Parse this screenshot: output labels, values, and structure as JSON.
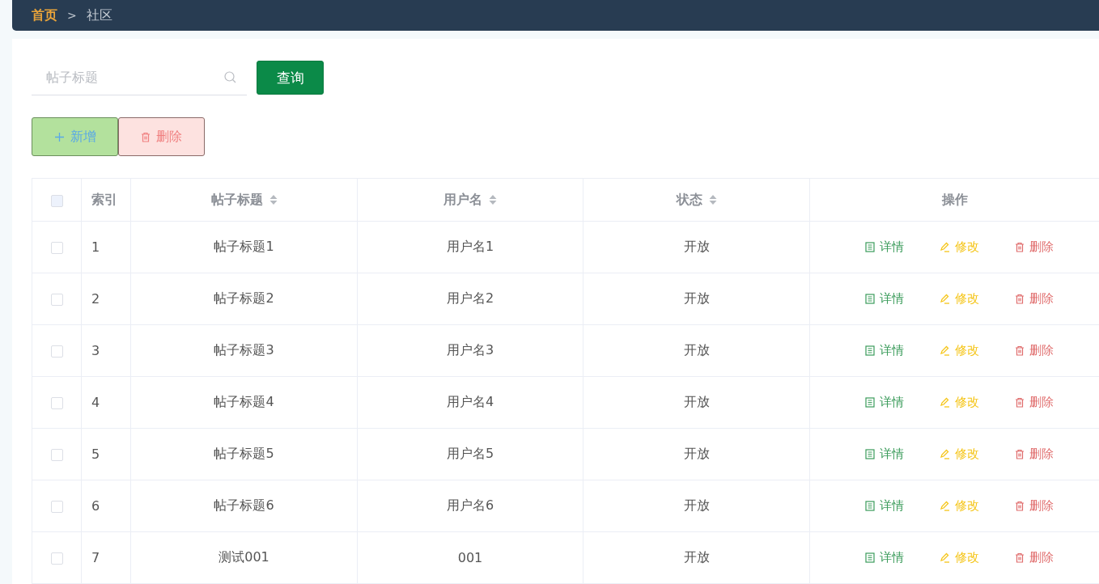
{
  "breadcrumb": [
    {
      "label": "首页",
      "current": false
    },
    {
      "label": "社区",
      "current": true
    }
  ],
  "breadcrumb_separator": ">",
  "search": {
    "placeholder": "帖子标题",
    "button": "查询"
  },
  "actions": [
    {
      "kind": "add",
      "label": "新增"
    },
    {
      "kind": "delete",
      "label": "删除"
    }
  ],
  "table": {
    "select_all": {
      "checked": false
    },
    "columns": [
      {
        "label": "索引",
        "sortable": false
      },
      {
        "label": "帖子标题",
        "sortable": true
      },
      {
        "label": "用户名",
        "sortable": true
      },
      {
        "label": "状态",
        "sortable": true
      },
      {
        "label": "操作",
        "sortable": false
      }
    ],
    "rows": [
      {
        "checked": false,
        "cells": [
          "1",
          "帖子标题1",
          "用户名1",
          "开放"
        ],
        "actions": [
          {
            "kind": "detail",
            "label": "详情"
          },
          {
            "kind": "edit",
            "label": "修改"
          },
          {
            "kind": "delete",
            "label": "删除"
          }
        ]
      },
      {
        "checked": false,
        "cells": [
          "2",
          "帖子标题2",
          "用户名2",
          "开放"
        ],
        "actions": [
          {
            "kind": "detail",
            "label": "详情"
          },
          {
            "kind": "edit",
            "label": "修改"
          },
          {
            "kind": "delete",
            "label": "删除"
          }
        ]
      },
      {
        "checked": false,
        "cells": [
          "3",
          "帖子标题3",
          "用户名3",
          "开放"
        ],
        "actions": [
          {
            "kind": "detail",
            "label": "详情"
          },
          {
            "kind": "edit",
            "label": "修改"
          },
          {
            "kind": "delete",
            "label": "删除"
          }
        ]
      },
      {
        "checked": false,
        "cells": [
          "4",
          "帖子标题4",
          "用户名4",
          "开放"
        ],
        "actions": [
          {
            "kind": "detail",
            "label": "详情"
          },
          {
            "kind": "edit",
            "label": "修改"
          },
          {
            "kind": "delete",
            "label": "删除"
          }
        ]
      },
      {
        "checked": false,
        "cells": [
          "5",
          "帖子标题5",
          "用户名5",
          "开放"
        ],
        "actions": [
          {
            "kind": "detail",
            "label": "详情"
          },
          {
            "kind": "edit",
            "label": "修改"
          },
          {
            "kind": "delete",
            "label": "删除"
          }
        ]
      },
      {
        "checked": false,
        "cells": [
          "6",
          "帖子标题6",
          "用户名6",
          "开放"
        ],
        "actions": [
          {
            "kind": "detail",
            "label": "详情"
          },
          {
            "kind": "edit",
            "label": "修改"
          },
          {
            "kind": "delete",
            "label": "删除"
          }
        ]
      },
      {
        "checked": false,
        "cells": [
          "7",
          "测试001",
          "001",
          "开放"
        ],
        "actions": [
          {
            "kind": "detail",
            "label": "详情"
          },
          {
            "kind": "edit",
            "label": "修改"
          },
          {
            "kind": "delete",
            "label": "删除"
          }
        ]
      }
    ]
  }
}
